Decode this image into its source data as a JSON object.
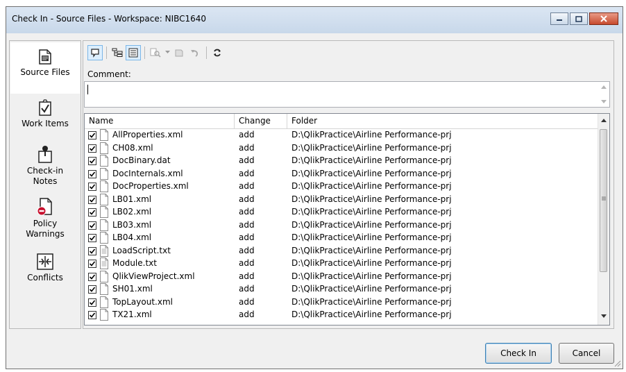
{
  "window": {
    "title": "Check In - Source Files - Workspace: NIBC1640"
  },
  "nav": {
    "items": [
      {
        "label_lines": [
          "Source Files"
        ],
        "icon": "document-icon"
      },
      {
        "label_lines": [
          "Work Items"
        ],
        "icon": "clipboard-check-icon"
      },
      {
        "label_lines": [
          "Check-in",
          "Notes"
        ],
        "icon": "pushpin-note-icon"
      },
      {
        "label_lines": [
          "Policy",
          "Warnings"
        ],
        "icon": "policy-warning-icon"
      },
      {
        "label_lines": [
          "Conflicts"
        ],
        "icon": "conflicts-icon"
      }
    ]
  },
  "comment": {
    "label": "Comment:",
    "value": ""
  },
  "table": {
    "columns": [
      "Name",
      "Change",
      "Folder"
    ],
    "rows": [
      {
        "name": "AllProperties.xml",
        "change": "add",
        "folder": "D:\\QlikPractice\\Airline Performance-prj"
      },
      {
        "name": "CH08.xml",
        "change": "add",
        "folder": "D:\\QlikPractice\\Airline Performance-prj"
      },
      {
        "name": "DocBinary.dat",
        "change": "add",
        "folder": "D:\\QlikPractice\\Airline Performance-prj"
      },
      {
        "name": "DocInternals.xml",
        "change": "add",
        "folder": "D:\\QlikPractice\\Airline Performance-prj"
      },
      {
        "name": "DocProperties.xml",
        "change": "add",
        "folder": "D:\\QlikPractice\\Airline Performance-prj"
      },
      {
        "name": "LB01.xml",
        "change": "add",
        "folder": "D:\\QlikPractice\\Airline Performance-prj"
      },
      {
        "name": "LB02.xml",
        "change": "add",
        "folder": "D:\\QlikPractice\\Airline Performance-prj"
      },
      {
        "name": "LB03.xml",
        "change": "add",
        "folder": "D:\\QlikPractice\\Airline Performance-prj"
      },
      {
        "name": "LB04.xml",
        "change": "add",
        "folder": "D:\\QlikPractice\\Airline Performance-prj"
      },
      {
        "name": "LoadScript.txt",
        "change": "add",
        "folder": "D:\\QlikPractice\\Airline Performance-prj"
      },
      {
        "name": "Module.txt",
        "change": "add",
        "folder": "D:\\QlikPractice\\Airline Performance-prj"
      },
      {
        "name": "QlikViewProject.xml",
        "change": "add",
        "folder": "D:\\QlikPractice\\Airline Performance-prj"
      },
      {
        "name": "SH01.xml",
        "change": "add",
        "folder": "D:\\QlikPractice\\Airline Performance-prj"
      },
      {
        "name": "TopLayout.xml",
        "change": "add",
        "folder": "D:\\QlikPractice\\Airline Performance-prj"
      },
      {
        "name": "TX21.xml",
        "change": "add",
        "folder": "D:\\QlikPractice\\Airline Performance-prj"
      }
    ]
  },
  "buttons": {
    "check_in": "Check In",
    "cancel": "Cancel"
  }
}
